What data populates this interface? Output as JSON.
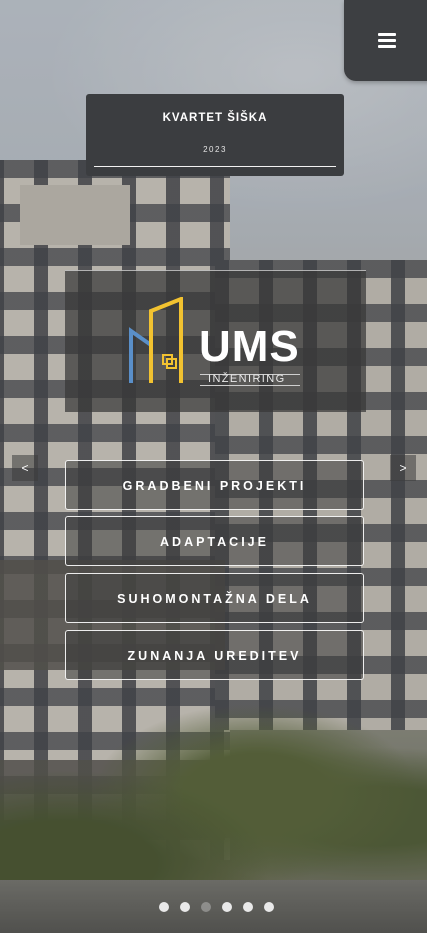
{
  "menu": {
    "icon": "hamburger-menu-icon"
  },
  "project": {
    "title": "KVARTET ŠIŠKA",
    "year": "2023"
  },
  "logo": {
    "name": "UMS",
    "subtitle": "INŽENIRING",
    "colors": {
      "accent": "#f2c230",
      "blue": "#5a8fc9"
    }
  },
  "carousel": {
    "prev_label": "<",
    "next_label": ">",
    "slide_count": 6,
    "active_slide": 3
  },
  "categories": [
    {
      "label": "GRADBENI PROJEKTI"
    },
    {
      "label": "ADAPTACIJE"
    },
    {
      "label": "SUHOMONTAŽNA DELA"
    },
    {
      "label": "ZUNANJA UREDITEV"
    }
  ],
  "colors": {
    "panel": "#3b3d40",
    "text": "#ffffff"
  }
}
